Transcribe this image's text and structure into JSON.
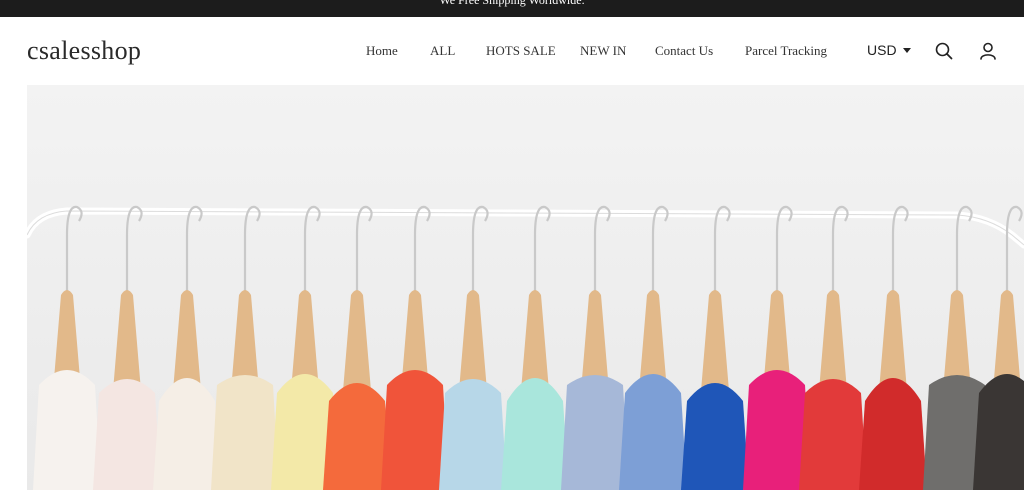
{
  "announcement": "We Free Shipping Worldwide.",
  "brand": "csalesshop",
  "nav": [
    {
      "label": "Home"
    },
    {
      "label": "ALL"
    },
    {
      "label": "HOTS SALE"
    },
    {
      "label": "NEW IN"
    },
    {
      "label": "Contact Us"
    },
    {
      "label": "Parcel Tracking"
    }
  ],
  "currency": "USD",
  "icons": {
    "search": "search-icon",
    "account": "user-icon",
    "currency_caret": "chevron-down-icon"
  },
  "colors": {
    "topbar": "#1c1c1c",
    "page_bg": "#ffffff",
    "text": "#333333"
  },
  "hero": {
    "image": "clothes-rack-banner"
  }
}
